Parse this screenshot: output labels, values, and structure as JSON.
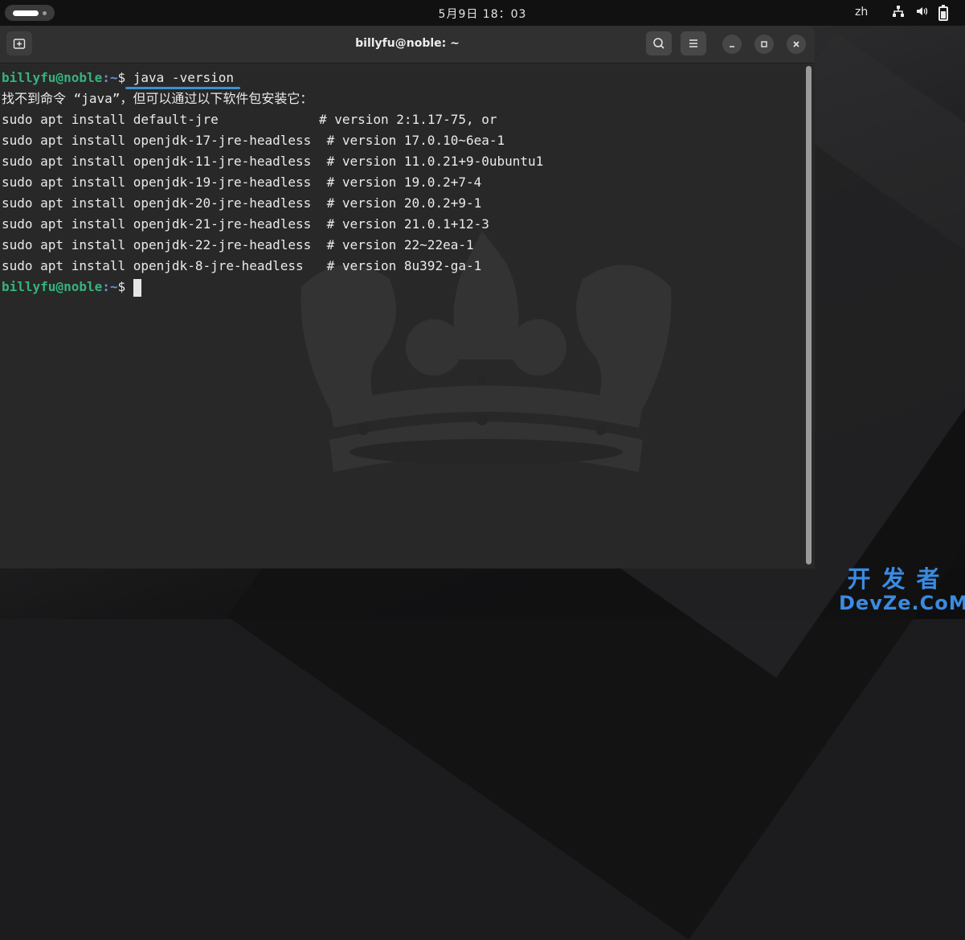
{
  "topbar": {
    "clock": "5月9日 18：03",
    "lang": "zh",
    "icons": [
      "activities-icon",
      "network-icon",
      "volume-icon",
      "battery-icon"
    ]
  },
  "window": {
    "title": "billyfu@noble: ~",
    "buttons": [
      "new-tab-icon",
      "search-icon",
      "menu-icon",
      "minimize-icon",
      "maximize-icon",
      "close-icon"
    ]
  },
  "terminal": {
    "prompt_user": "billyfu@noble",
    "prompt_path": ":~",
    "prompt_symbol": "$ ",
    "command": "java -version",
    "message": "找不到命令 “java”，但可以通过以下软件包安装它：",
    "suggestions": [
      {
        "pkg": "sudo apt install default-jre             ",
        "ver": "# version 2:1.17-75, or"
      },
      {
        "pkg": "sudo apt install openjdk-17-jre-headless  ",
        "ver": "# version 17.0.10~6ea-1"
      },
      {
        "pkg": "sudo apt install openjdk-11-jre-headless  ",
        "ver": "# version 11.0.21+9-0ubuntu1"
      },
      {
        "pkg": "sudo apt install openjdk-19-jre-headless  ",
        "ver": "# version 19.0.2+7-4"
      },
      {
        "pkg": "sudo apt install openjdk-20-jre-headless  ",
        "ver": "# version 20.0.2+9-1"
      },
      {
        "pkg": "sudo apt install openjdk-21-jre-headless  ",
        "ver": "# version 21.0.1+12-3"
      },
      {
        "pkg": "sudo apt install openjdk-22-jre-headless  ",
        "ver": "# version 22~22ea-1"
      },
      {
        "pkg": "sudo apt install openjdk-8-jre-headless   ",
        "ver": "# version 8u392-ga-1"
      }
    ]
  },
  "watermark": {
    "line1": "开发者",
    "line2": "DevZe.CoM"
  },
  "colors": {
    "prompt_user": "#36b37e",
    "prompt_path": "#6f8fd6",
    "highlight": "#3a91d6",
    "watermark": "#3b8be0"
  }
}
